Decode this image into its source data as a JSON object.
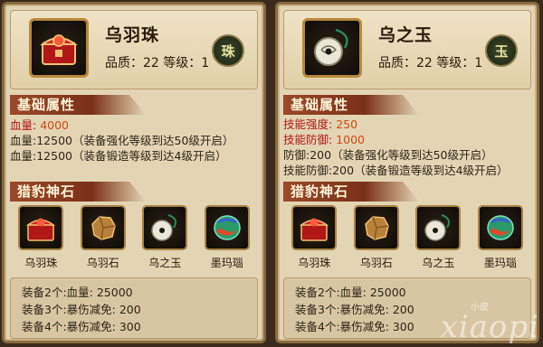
{
  "left": {
    "item": {
      "name": "乌羽珠",
      "quality_level": "品质：22 等级：1",
      "badge": "珠",
      "icon": "red-chest-icon"
    },
    "base_title": "基础属性",
    "attrs": [
      {
        "label": "血量:",
        "value": "4000",
        "style": "highlight"
      },
      {
        "label": "血量:12500",
        "value": "（装备强化等级到达50级开启）",
        "style": "normal"
      },
      {
        "label": "血量:12500",
        "value": "（装备锻造等级到达4级开启）",
        "style": "normal"
      }
    ],
    "stones_title": "猎豹神石",
    "stones": [
      {
        "label": "乌羽珠",
        "icon": "red-chest-icon"
      },
      {
        "label": "乌羽石",
        "icon": "gold-ore-icon"
      },
      {
        "label": "乌之玉",
        "icon": "jade-pendant-icon"
      },
      {
        "label": "墨玛瑙",
        "icon": "agate-gem-icon"
      }
    ],
    "set_bonus": [
      "装备2个:血量: 25000",
      "装备3个:暴伤减免: 200",
      "装备4个:暴伤减免: 300"
    ]
  },
  "right": {
    "item": {
      "name": "乌之玉",
      "quality_level": "品质：22 等级：1",
      "badge": "玉",
      "icon": "jade-pendant-icon"
    },
    "base_title": "基础属性",
    "attrs": [
      {
        "label": "技能强度:",
        "value": "250",
        "style": "highlight"
      },
      {
        "label": "技能防御:",
        "value": "1000",
        "style": "highlight"
      },
      {
        "label": "防御:200",
        "value": "（装备强化等级到达50级开启）",
        "style": "normal"
      },
      {
        "label": "技能防御:200",
        "value": "（装备锻造等级到达4级开启）",
        "style": "normal"
      }
    ],
    "stones_title": "猎豹神石",
    "stones": [
      {
        "label": "乌羽珠",
        "icon": "red-chest-icon"
      },
      {
        "label": "乌羽石",
        "icon": "gold-ore-icon"
      },
      {
        "label": "乌之玉",
        "icon": "jade-pendant-icon"
      },
      {
        "label": "墨玛瑙",
        "icon": "agate-gem-icon"
      }
    ],
    "set_bonus": [
      "装备2个:血量: 25000",
      "装备3个:暴伤减免: 200",
      "装备4个:暴伤减免: 300"
    ]
  },
  "watermark": {
    "big": "xiaopi",
    "small": "小皮"
  },
  "colors": {
    "panel_bg": "#e3d4b4",
    "border": "#8a6a3e",
    "tab_red": "#7a3018",
    "highlight_label": "#b01818",
    "highlight_value": "#d24a10"
  }
}
